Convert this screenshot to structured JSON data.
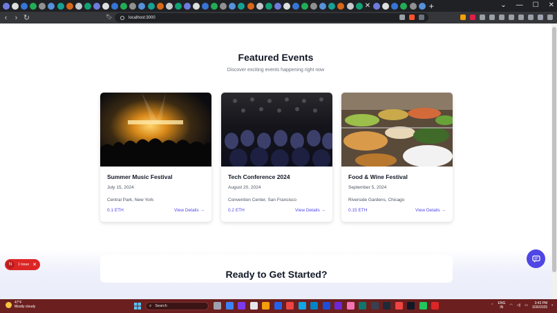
{
  "browser": {
    "tab_count_icons": 46,
    "new_tab_label": "+",
    "url": "localhost:3000",
    "window_controls": [
      "⌄",
      "—",
      "☐",
      "✕"
    ]
  },
  "page": {
    "section_title": "Featured Events",
    "section_subtitle": "Discover exciting events happening right now",
    "events": [
      {
        "title": "Summer Music Festival",
        "date": "July 15, 2024",
        "location": "Central Park, New York",
        "price": "0.1 ETH",
        "link": "View Details →",
        "image": "concert-stage-image"
      },
      {
        "title": "Tech Conference 2024",
        "date": "August 20, 2024",
        "location": "Convention Center, San Francisco",
        "price": "0.2 ETH",
        "link": "View Details →",
        "image": "conference-audience-image"
      },
      {
        "title": "Food & Wine Festival",
        "date": "September 5, 2024",
        "location": "Riverside Gardens, Chicago",
        "price": "0.15 ETH",
        "link": "View Details →",
        "image": "food-buffet-image"
      }
    ],
    "cta_title": "Ready to Get Started?",
    "accent_color": "#4f46e5"
  },
  "dev_overlay": {
    "logo_letter": "N",
    "issue_label": "1 Issue",
    "close_label": "✕"
  },
  "taskbar": {
    "temperature": "47°F",
    "weather": "Mostly cloudy",
    "search_placeholder": "Search",
    "language": "ENG",
    "region": "IN",
    "time": "3:43 PM",
    "date": "3/30/2025"
  }
}
